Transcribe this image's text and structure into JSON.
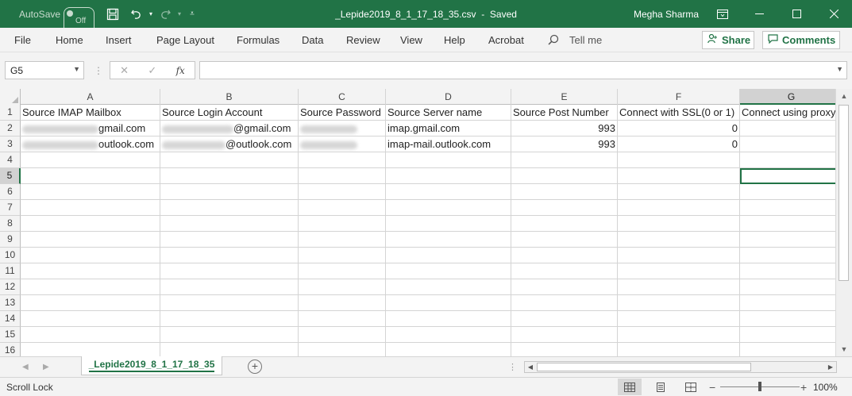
{
  "colors": {
    "excel_green": "#217346",
    "ribbon_bg": "#f3f3f3"
  },
  "titlebar": {
    "autosave_label": "AutoSave",
    "autosave_state": "Off",
    "document_title": "_Lepide2019_8_1_17_18_35.csv",
    "save_status": "Saved",
    "separator": "-",
    "user_name": "Megha Sharma"
  },
  "ribbon": {
    "tabs": [
      "File",
      "Home",
      "Insert",
      "Page Layout",
      "Formulas",
      "Data",
      "Review",
      "View",
      "Help",
      "Acrobat"
    ],
    "tell_me": "Tell me",
    "share_label": "Share",
    "comments_label": "Comments"
  },
  "formula_bar": {
    "name_box": "G5",
    "formula": ""
  },
  "grid": {
    "columns": [
      "A",
      "B",
      "C",
      "D",
      "E",
      "F",
      "G"
    ],
    "selected_column": "G",
    "row_numbers": [
      "1",
      "2",
      "3",
      "4",
      "5",
      "6",
      "7",
      "8",
      "9",
      "10",
      "11",
      "12",
      "13",
      "14",
      "15",
      "16"
    ],
    "selected_row": "5",
    "rows": [
      [
        "Source IMAP Mailbox",
        "Source Login Account",
        "Source Password",
        "Source Server name",
        "Source Post Number",
        "Connect with SSL(0 or 1)",
        "Connect using proxy"
      ],
      [
        "gmail.com",
        "@gmail.com",
        "",
        "imap.gmail.com",
        "993",
        "0",
        ""
      ],
      [
        "outlook.com",
        "@outlook.com",
        "",
        "imap-mail.outlook.com",
        "993",
        "0",
        ""
      ]
    ]
  },
  "sheets": {
    "tabs": [
      "_Lepide2019_8_1_17_18_35"
    ],
    "active": "_Lepide2019_8_1_17_18_35"
  },
  "statusbar": {
    "status": "Scroll Lock",
    "zoom": "100%",
    "zoom_fraction": 0.5
  }
}
